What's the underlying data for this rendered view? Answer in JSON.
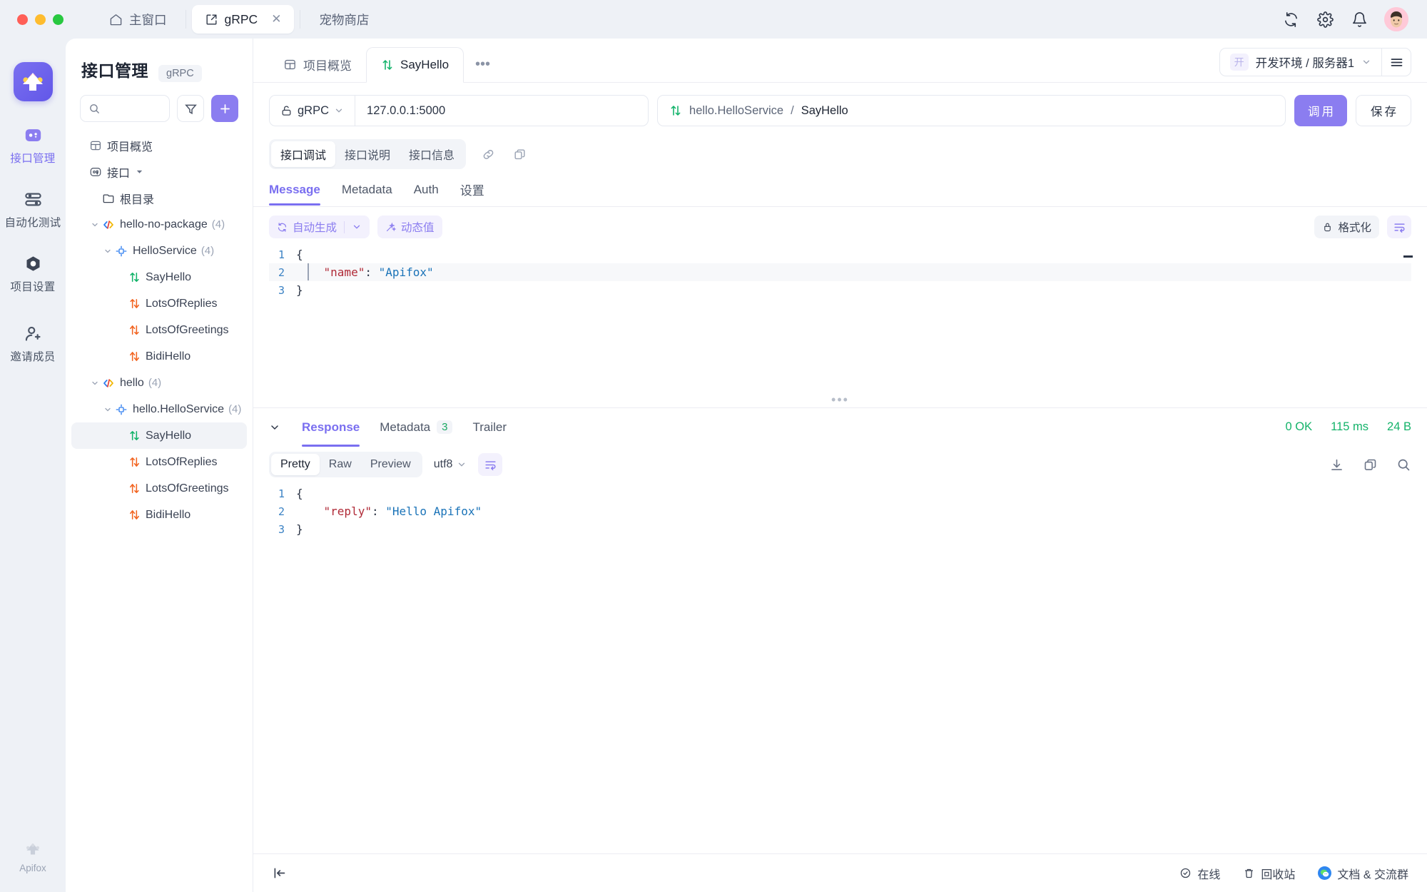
{
  "window": {
    "tabs": [
      {
        "label": "主窗口",
        "icon": "home-icon",
        "active": false,
        "closable": false
      },
      {
        "label": "gRPC",
        "icon": "external-link-icon",
        "active": true,
        "closable": true
      },
      {
        "label": "宠物商店",
        "icon": "none",
        "active": false,
        "closable": false
      }
    ],
    "actions": [
      "sync-icon",
      "gear-icon",
      "bell-icon",
      "avatar"
    ]
  },
  "rail": {
    "logo": "apifox-logo",
    "items": [
      {
        "label": "接口管理",
        "icon": "api-icon",
        "active": true
      },
      {
        "label": "自动化测试",
        "icon": "layers-icon",
        "active": false
      },
      {
        "label": "项目设置",
        "icon": "nut-icon",
        "active": false
      },
      {
        "label": "邀请成员",
        "icon": "user-plus-icon",
        "active": false
      }
    ],
    "footer": {
      "label": "Apifox",
      "icon": "apifox-mark-icon"
    }
  },
  "sidebar": {
    "title": "接口管理",
    "badge": "gRPC",
    "search": {
      "value": "",
      "placeholder": ""
    },
    "filter_icon": "filter-icon",
    "add_icon": "plus-icon",
    "tree": [
      {
        "label": "项目概览",
        "icon": "overview-icon",
        "indent": 0,
        "caret": "none",
        "count": "",
        "selected": false
      },
      {
        "label": "接口",
        "icon": "api-icon",
        "indent": 0,
        "caret": "down-small",
        "count": "",
        "selected": false
      },
      {
        "label": "根目录",
        "icon": "folder-icon",
        "indent": 1,
        "caret": "none",
        "count": "",
        "selected": false
      },
      {
        "label": "hello-no-package",
        "icon": "code-icon",
        "indent": 1,
        "caret": "down",
        "count": "(4)",
        "selected": false
      },
      {
        "label": "HelloService",
        "icon": "service-icon",
        "indent": 2,
        "caret": "down",
        "count": "(4)",
        "selected": false
      },
      {
        "label": "SayHello",
        "icon": "unary-icon",
        "indent": 3,
        "caret": "none",
        "count": "",
        "selected": false
      },
      {
        "label": "LotsOfReplies",
        "icon": "server-stream-icon",
        "indent": 3,
        "caret": "none",
        "count": "",
        "selected": false
      },
      {
        "label": "LotsOfGreetings",
        "icon": "client-stream-icon",
        "indent": 3,
        "caret": "none",
        "count": "",
        "selected": false
      },
      {
        "label": "BidiHello",
        "icon": "bidi-stream-icon",
        "indent": 3,
        "caret": "none",
        "count": "",
        "selected": false
      },
      {
        "label": "hello",
        "icon": "code-icon",
        "indent": 1,
        "caret": "down",
        "count": "(4)",
        "selected": false
      },
      {
        "label": "hello.HelloService",
        "icon": "service-icon",
        "indent": 2,
        "caret": "down",
        "count": "(4)",
        "selected": false
      },
      {
        "label": "SayHello",
        "icon": "unary-icon",
        "indent": 3,
        "caret": "none",
        "count": "",
        "selected": true
      },
      {
        "label": "LotsOfReplies",
        "icon": "server-stream-icon",
        "indent": 3,
        "caret": "none",
        "count": "",
        "selected": false
      },
      {
        "label": "LotsOfGreetings",
        "icon": "client-stream-icon",
        "indent": 3,
        "caret": "none",
        "count": "",
        "selected": false
      },
      {
        "label": "BidiHello",
        "icon": "bidi-stream-icon",
        "indent": 3,
        "caret": "none",
        "count": "",
        "selected": false
      }
    ]
  },
  "main": {
    "tabs": [
      {
        "label": "项目概览",
        "icon": "overview-icon",
        "active": false
      },
      {
        "label": "SayHello",
        "icon": "unary-icon",
        "active": true
      }
    ],
    "more_label": "•••",
    "env": {
      "tag": "开",
      "label": "开发环境 / 服务器1",
      "caret": "chevron-down-icon",
      "menu_icon": "hamburger-icon"
    },
    "request": {
      "protocol": "gRPC",
      "protocol_icon": "unlock-icon",
      "url": "127.0.0.1:5000",
      "service": "hello.HelloService",
      "separator": "/",
      "method": "SayHello",
      "method_icon": "unary-icon",
      "call_label": "调用",
      "save_label": "保存"
    },
    "doc_tabs": [
      {
        "label": "接口调试",
        "active": true
      },
      {
        "label": "接口说明",
        "active": false
      },
      {
        "label": "接口信息",
        "active": false
      }
    ],
    "doc_icons": [
      "link-icon",
      "copy-icon"
    ],
    "message_tabs": [
      {
        "label": "Message",
        "active": true
      },
      {
        "label": "Metadata",
        "active": false
      },
      {
        "label": "Auth",
        "active": false
      },
      {
        "label": "设置",
        "active": false
      }
    ],
    "editor_toolbar": {
      "autogen_label": "自动生成",
      "autogen_icon": "refresh-icon",
      "autogen_caret": "chevron-down-icon",
      "dynamic_label": "动态值",
      "dynamic_icon": "wand-icon",
      "format_label": "格式化",
      "format_icon": "broom-icon",
      "wrap_icon": "wrap-text-icon"
    },
    "request_body": {
      "lines": [
        {
          "n": "1",
          "tokens": [
            {
              "t": "{",
              "c": "pun"
            }
          ],
          "highlight": false
        },
        {
          "n": "2",
          "tokens": [
            {
              "t": "    ",
              "c": "pun"
            },
            {
              "t": "\"name\"",
              "c": "key"
            },
            {
              "t": ": ",
              "c": "pun"
            },
            {
              "t": "\"Apifox\"",
              "c": "str"
            }
          ],
          "highlight": true
        },
        {
          "n": "3",
          "tokens": [
            {
              "t": "}",
              "c": "pun"
            }
          ],
          "highlight": false
        }
      ]
    },
    "response": {
      "collapse_icon": "chevron-down-icon",
      "tabs": [
        {
          "label": "Response",
          "active": true,
          "count": ""
        },
        {
          "label": "Metadata",
          "active": false,
          "count": "3"
        },
        {
          "label": "Trailer",
          "active": false,
          "count": ""
        }
      ],
      "status": "0 OK",
      "time": "115 ms",
      "size": "24 B",
      "view_modes": [
        {
          "label": "Pretty",
          "active": true
        },
        {
          "label": "Raw",
          "active": false
        },
        {
          "label": "Preview",
          "active": false
        }
      ],
      "encoding": "utf8",
      "encoding_caret": "chevron-down-icon",
      "wrap_icon": "wrap-text-icon",
      "actions": [
        "download-icon",
        "copy-icon",
        "search-icon"
      ],
      "body": {
        "lines": [
          {
            "n": "1",
            "tokens": [
              {
                "t": "{",
                "c": "pun"
              }
            ],
            "highlight": false
          },
          {
            "n": "2",
            "tokens": [
              {
                "t": "    ",
                "c": "pun"
              },
              {
                "t": "\"reply\"",
                "c": "key"
              },
              {
                "t": ": ",
                "c": "pun"
              },
              {
                "t": "\"Hello Apifox\"",
                "c": "str"
              }
            ],
            "highlight": false
          },
          {
            "n": "3",
            "tokens": [
              {
                "t": "}",
                "c": "pun"
              }
            ],
            "highlight": false
          }
        ]
      }
    },
    "statusbar": {
      "collapse_icon": "collapse-left-icon",
      "items": [
        {
          "label": "在线",
          "icon": "check-circle-icon"
        },
        {
          "label": "回收站",
          "icon": "trash-icon"
        },
        {
          "label": "文档 & 交流群",
          "icon": "wechat-icon"
        }
      ]
    }
  },
  "colors": {
    "accent": "#8b7df0",
    "success": "#14b36a",
    "unary": "#13b36a",
    "stream": "#f26522",
    "bg": "#eef1f6"
  }
}
